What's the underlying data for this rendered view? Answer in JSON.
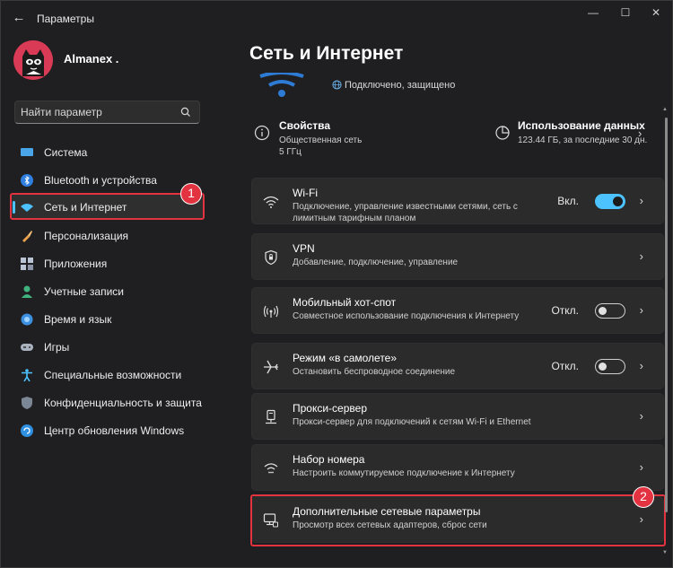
{
  "window": {
    "title": "Параметры",
    "back_glyph": "←",
    "min_glyph": "—",
    "max_glyph": "☐",
    "close_glyph": "✕"
  },
  "user": {
    "name": "Almanex ."
  },
  "search": {
    "placeholder": "Найти параметр"
  },
  "sidebar": {
    "items": [
      {
        "label": "Система",
        "icon": "system-icon",
        "active": false
      },
      {
        "label": "Bluetooth и устройства",
        "icon": "bluetooth-icon",
        "active": false
      },
      {
        "label": "Сеть и Интернет",
        "icon": "network-icon",
        "active": true
      },
      {
        "label": "Персонализация",
        "icon": "brush-icon",
        "active": false
      },
      {
        "label": "Приложения",
        "icon": "apps-icon",
        "active": false
      },
      {
        "label": "Учетные записи",
        "icon": "accounts-icon",
        "active": false
      },
      {
        "label": "Время и язык",
        "icon": "globe-clock-icon",
        "active": false
      },
      {
        "label": "Игры",
        "icon": "gamepad-icon",
        "active": false
      },
      {
        "label": "Специальные возможности",
        "icon": "accessibility-icon",
        "active": false
      },
      {
        "label": "Конфиденциальность и защита",
        "icon": "shield-icon",
        "active": false
      },
      {
        "label": "Центр обновления Windows",
        "icon": "update-icon",
        "active": false
      }
    ]
  },
  "badges": {
    "first": "1",
    "second": "2"
  },
  "main": {
    "title": "Сеть и Интернет",
    "connection_status": "Подключено, защищено",
    "properties": {
      "title": "Свойства",
      "line1": "Общественная сеть",
      "line2": "5 ГГц"
    },
    "data_usage": {
      "title": "Использование данных",
      "detail": "123.44 ГБ, за последние 30 дн."
    },
    "cards": [
      {
        "title": "Wi-Fi",
        "subtitle": "Подключение, управление известными сетями, сеть с лимитным тарифным планом",
        "state": "Вкл.",
        "toggle": true
      },
      {
        "title": "VPN",
        "subtitle": "Добавление, подключение, управление",
        "state": "",
        "toggle": null
      },
      {
        "title": "Мобильный хот-спот",
        "subtitle": "Совместное использование подключения к Интернету",
        "state": "Откл.",
        "toggle": false
      },
      {
        "title": "Режим «в самолете»",
        "subtitle": "Остановить беспроводное соединение",
        "state": "Откл.",
        "toggle": false
      },
      {
        "title": "Прокси-сервер",
        "subtitle": "Прокси-сервер для подключений к сетям Wi-Fi и Ethernet",
        "state": "",
        "toggle": null
      },
      {
        "title": "Набор номера",
        "subtitle": "Настроить коммутируемое подключение к Интернету",
        "state": "",
        "toggle": null
      },
      {
        "title": "Дополнительные сетевые параметры",
        "subtitle": "Просмотр всех сетевых адаптеров, сброс сети",
        "state": "",
        "toggle": null
      }
    ],
    "chevron": "›"
  },
  "colors": {
    "accent": "#4cc2ff",
    "highlight": "#e33240",
    "avatar": "#d93a55"
  }
}
